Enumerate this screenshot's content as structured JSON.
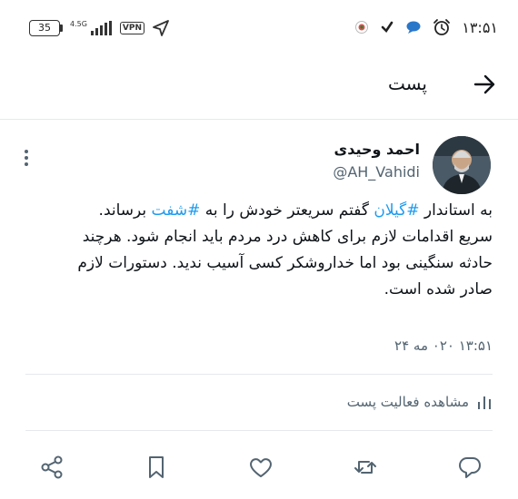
{
  "status_bar": {
    "time": "۱۳:۵۱",
    "battery": "35",
    "network": "4.5G",
    "vpn": "VPN",
    "icons": [
      "alarm-icon",
      "chat-bubble-icon",
      "check-icon",
      "app-notification-icon",
      "signal-icon",
      "location-arrow-icon"
    ]
  },
  "header": {
    "title": "پست",
    "back_icon": "arrow-right-icon"
  },
  "tweet": {
    "author_name": "احمد وحیدی",
    "author_handle": "@AH_Vahidi",
    "text": {
      "line1_pre": "به استاندار ",
      "hashtag1": "#گیلان",
      "line1_mid": " گفتم سریعتر خودش را به ",
      "hashtag2": "#شفت",
      "line1_post": " برساند.",
      "line2": "سریع اقدامات لازم برای کاهش درد مردم باید انجام شود. هرچند",
      "line3": "حادثه سنگینی بود اما خداروشکر کسی آسیب ندید. دستورات لازم",
      "line4": "صادر شده است."
    },
    "timestamp": "۱۳:۵۱ ۰۲۰ مه ۲۴"
  },
  "activity": {
    "label": "مشاهده فعالیت پست",
    "icon": "bar-chart-icon"
  },
  "actions": {
    "icons": [
      "reply-icon",
      "retweet-icon",
      "like-icon",
      "bookmark-icon",
      "share-icon"
    ]
  },
  "colors": {
    "hashtag": "#1d9bf0",
    "secondary_text": "#536471",
    "divider": "#e6e9ec",
    "primary_text": "#0f1419"
  }
}
